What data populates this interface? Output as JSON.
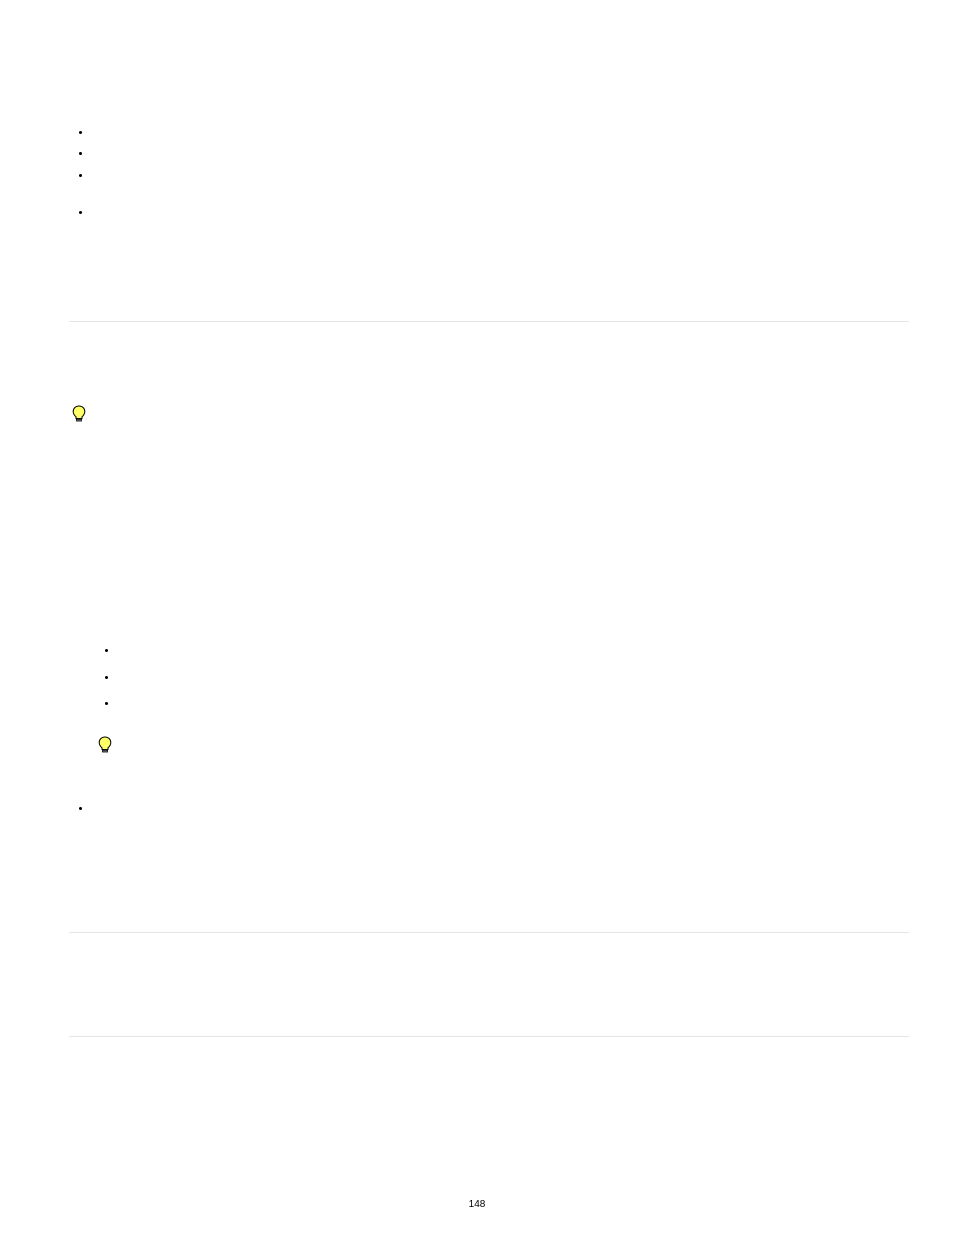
{
  "page_number": "148",
  "bullets_top": [
    {
      "id": "b1"
    },
    {
      "id": "b2"
    },
    {
      "id": "b3"
    },
    {
      "id": "b4"
    }
  ],
  "bulb1": {
    "name": "lightbulb-icon"
  },
  "bullets_mid": [
    {
      "id": "m1"
    },
    {
      "id": "m2"
    },
    {
      "id": "m3"
    }
  ],
  "bulb2": {
    "name": "lightbulb-icon"
  },
  "bullets_lower": [
    {
      "id": "l1"
    }
  ]
}
